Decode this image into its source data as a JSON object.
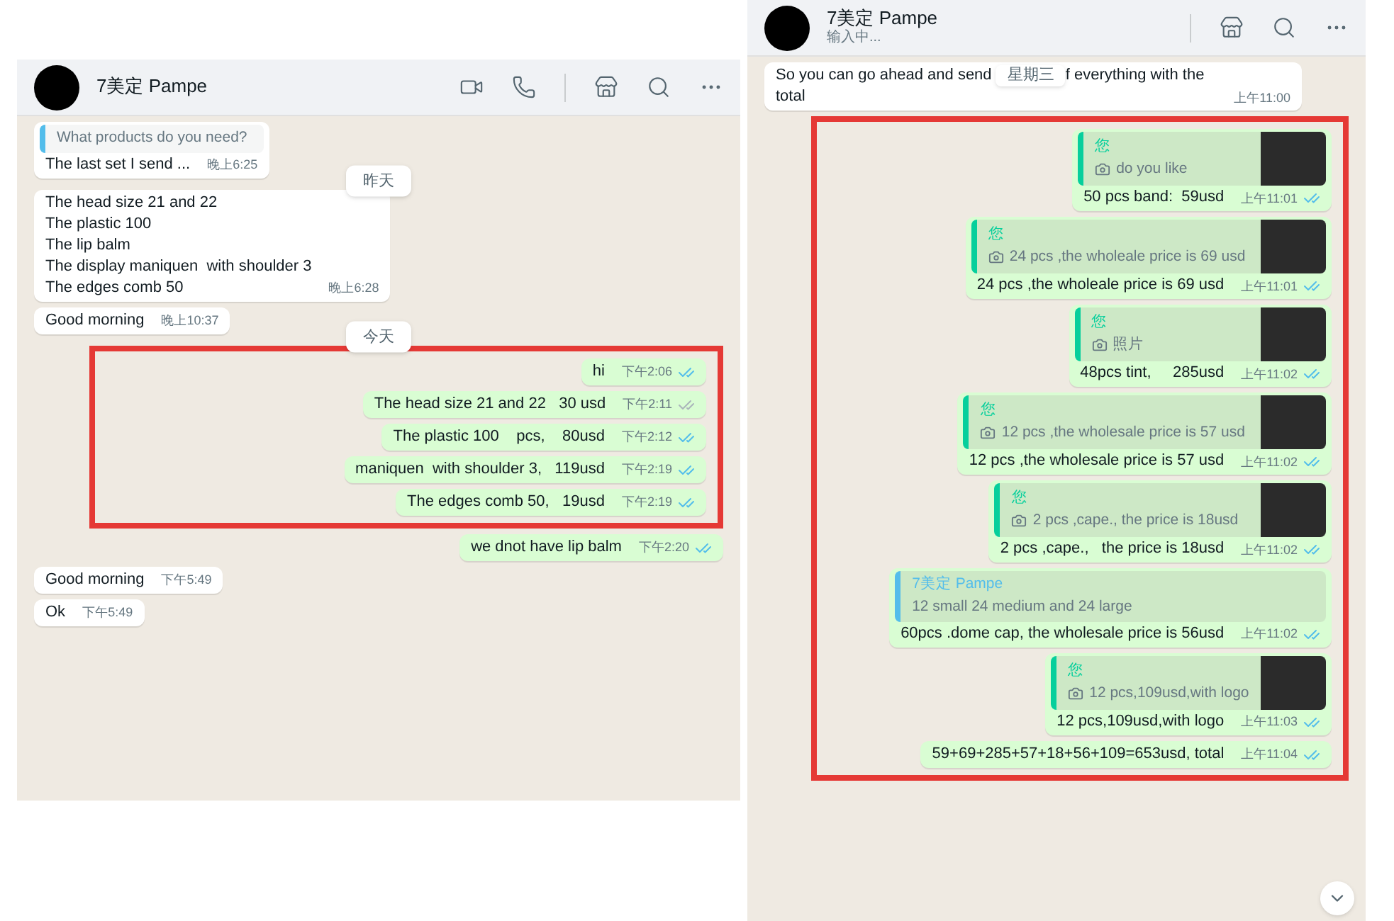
{
  "panels": [
    {
      "header": {
        "name": "7美定 Pampe",
        "icons": [
          {
            "kind": "video"
          },
          {
            "kind": "phone"
          },
          {
            "kind": "divider"
          },
          {
            "kind": "store"
          },
          {
            "kind": "search"
          },
          {
            "kind": "more"
          }
        ]
      },
      "scroll_down_button": false,
      "items": [
        {
          "kind": "received",
          "quote": {
            "text": "What products do you need?"
          },
          "text": "The last set I send ...",
          "time": "晚上6:25"
        },
        {
          "kind": "date",
          "label": "昨天"
        },
        {
          "kind": "received",
          "text": "The head size 21 and 22\nThe plastic 100\nThe lip balm\nThe display maniquen  with shoulder 3\nThe edges comb 50",
          "time": "晚上6:28"
        },
        {
          "kind": "received",
          "text": "Good morning",
          "time": "晚上10:37"
        },
        {
          "kind": "date",
          "label": "今天"
        },
        {
          "kind": "highlight",
          "items": [
            {
              "kind": "sent",
              "text": "hi",
              "time": "下午2:06",
              "read": true
            },
            {
              "kind": "sent",
              "text": "The head size 21 and 22   30 usd",
              "time": "下午2:11",
              "read": false
            },
            {
              "kind": "sent",
              "text": "The plastic 100    pcs,    80usd",
              "time": "下午2:12",
              "read": true
            },
            {
              "kind": "sent",
              "text": "maniquen  with shoulder 3,   119usd",
              "time": "下午2:19",
              "read": true
            },
            {
              "kind": "sent",
              "text": "The edges comb 50,   19usd",
              "time": "下午2:19",
              "read": true
            }
          ]
        },
        {
          "kind": "sent",
          "text": "we dnot have lip balm",
          "time": "下午2:20",
          "read": true
        },
        {
          "kind": "received",
          "text": "Good morning",
          "time": "下午5:49"
        },
        {
          "kind": "received",
          "text": "Ok",
          "time": "下午5:49"
        }
      ]
    },
    {
      "header": {
        "name": "7美定 Pampe",
        "status": "输入中...",
        "icons": [
          {
            "kind": "divider"
          },
          {
            "kind": "store"
          },
          {
            "kind": "search"
          },
          {
            "kind": "more"
          }
        ]
      },
      "scroll_down_button": true,
      "items": [
        {
          "kind": "received",
          "text": "So you can go ahead and send",
          "overlay_date": "星期三",
          "text_end": "f everything with the total",
          "time": "上午11:00"
        },
        {
          "kind": "highlight",
          "items": [
            {
              "kind": "sent",
              "quote": {
                "author": "您",
                "color": "#06cf9c",
                "photo": true,
                "text": "do you like",
                "thumbnail": true
              },
              "text": "50 pcs band:  59usd",
              "time": "上午11:01",
              "read": true
            },
            {
              "kind": "sent",
              "quote": {
                "author": "您",
                "color": "#06cf9c",
                "photo": true,
                "text": "24 pcs ,the wholeale price is 69 usd",
                "thumbnail": true
              },
              "text": "24 pcs ,the wholeale price is 69 usd",
              "time": "上午11:01",
              "read": true
            },
            {
              "kind": "sent",
              "quote": {
                "author": "您",
                "color": "#06cf9c",
                "photo": true,
                "text": "照片",
                "thumbnail": true
              },
              "text": "48pcs tint,     285usd",
              "time": "上午11:02",
              "read": true
            },
            {
              "kind": "sent",
              "quote": {
                "author": "您",
                "color": "#06cf9c",
                "photo": true,
                "text": "12 pcs ,the wholesale price is 57 usd",
                "thumbnail": true
              },
              "text": "12 pcs ,the wholesale price is 57 usd",
              "time": "上午11:02",
              "read": true
            },
            {
              "kind": "sent",
              "quote": {
                "author": "您",
                "color": "#06cf9c",
                "photo": true,
                "text": "2 pcs ,cape.,   the price is 18usd",
                "thumbnail": true
              },
              "text": "2 pcs ,cape.,   the price is 18usd",
              "time": "上午11:02",
              "read": true
            },
            {
              "kind": "sent",
              "quote": {
                "author": "7美定 Pampe",
                "color": "#53bdeb",
                "text": "12 small 24 medium and 24 large"
              },
              "text": "60pcs .dome cap, the wholesale price is 56usd",
              "time": "上午11:02",
              "read": true
            },
            {
              "kind": "sent",
              "quote": {
                "author": "您",
                "color": "#06cf9c",
                "photo": true,
                "text": "12 pcs,109usd,with logo",
                "thumbnail": true
              },
              "text": "12 pcs,109usd,with logo",
              "time": "上午11:03",
              "read": true
            },
            {
              "kind": "sent",
              "text": "59+69+285+57+18+56+109=653usd, total",
              "time": "上午11:04",
              "read": true
            }
          ]
        }
      ]
    }
  ]
}
